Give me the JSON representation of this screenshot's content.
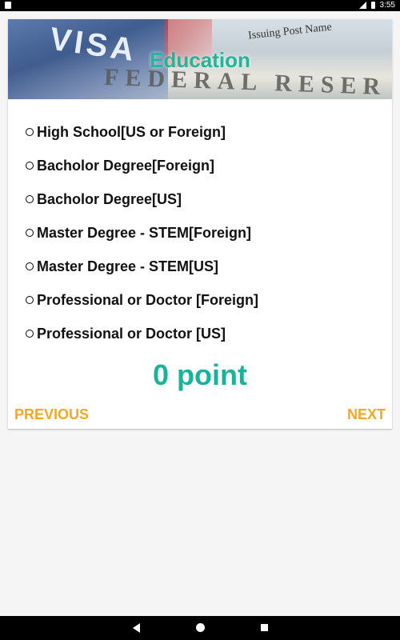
{
  "status_bar": {
    "time": "3:55",
    "icons": [
      "notification-icon",
      "signal-icon",
      "battery-icon"
    ]
  },
  "banner": {
    "title": "Education",
    "image_text": {
      "visa": "VISA",
      "issuing": "Issuing Post Name",
      "reserve": "FEDERAL RESER"
    }
  },
  "options": [
    {
      "label": "High School[US or Foreign]",
      "selected": false
    },
    {
      "label": "Bacholor Degree[Foreign]",
      "selected": false
    },
    {
      "label": "Bacholor Degree[US]",
      "selected": false
    },
    {
      "label": "Master Degree - STEM[Foreign]",
      "selected": false
    },
    {
      "label": "Master Degree - STEM[US]",
      "selected": false
    },
    {
      "label": "Professional or Doctor [Foreign]",
      "selected": false
    },
    {
      "label": "Professional or Doctor [US]",
      "selected": false
    }
  ],
  "score": "0 point",
  "buttons": {
    "previous": "PREVIOUS",
    "next": "NEXT"
  },
  "colors": {
    "accent_teal": "#1ab39a",
    "button_orange": "#f6a623"
  },
  "navbar": {
    "icons": [
      "back-icon",
      "home-icon",
      "recents-icon"
    ]
  }
}
